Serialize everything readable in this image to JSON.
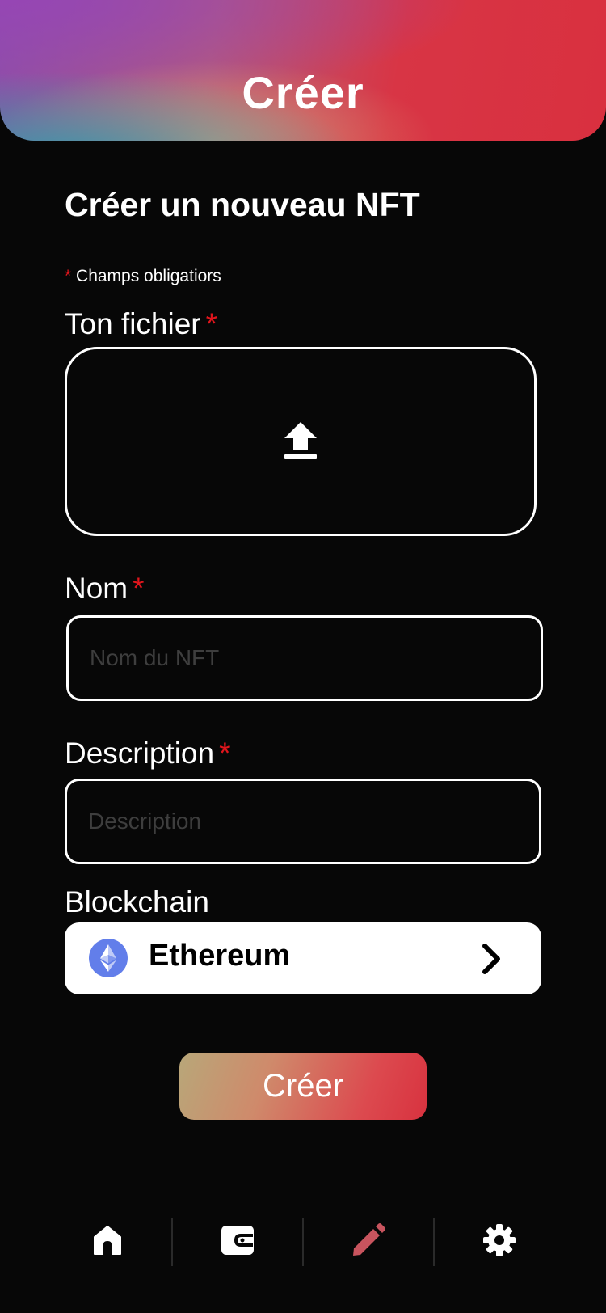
{
  "header": {
    "title": "Créer"
  },
  "form": {
    "heading": "Créer un nouveau NFT",
    "required_star": "*",
    "required_note": "Champs obligatiors",
    "file": {
      "label": "Ton fichier",
      "upload_icon": "upload-icon"
    },
    "name": {
      "label": "Nom",
      "value": "",
      "placeholder": "Nom du NFT"
    },
    "description": {
      "label": "Description",
      "value": "",
      "placeholder": "Description"
    },
    "blockchain": {
      "label": "Blockchain",
      "value": "Ethereum",
      "icon": "ethereum-icon"
    },
    "submit_label": "Créer"
  },
  "bottom_nav": {
    "items": [
      {
        "name": "home",
        "icon": "home-icon",
        "active": false
      },
      {
        "name": "wallet",
        "icon": "wallet-icon",
        "active": false
      },
      {
        "name": "create",
        "icon": "pencil-icon",
        "active": true
      },
      {
        "name": "settings",
        "icon": "gear-icon",
        "active": false
      }
    ]
  },
  "colors": {
    "background": "#070707",
    "required": "#e0151c",
    "active_nav": "#c8545e",
    "ethereum": "#627eea"
  }
}
